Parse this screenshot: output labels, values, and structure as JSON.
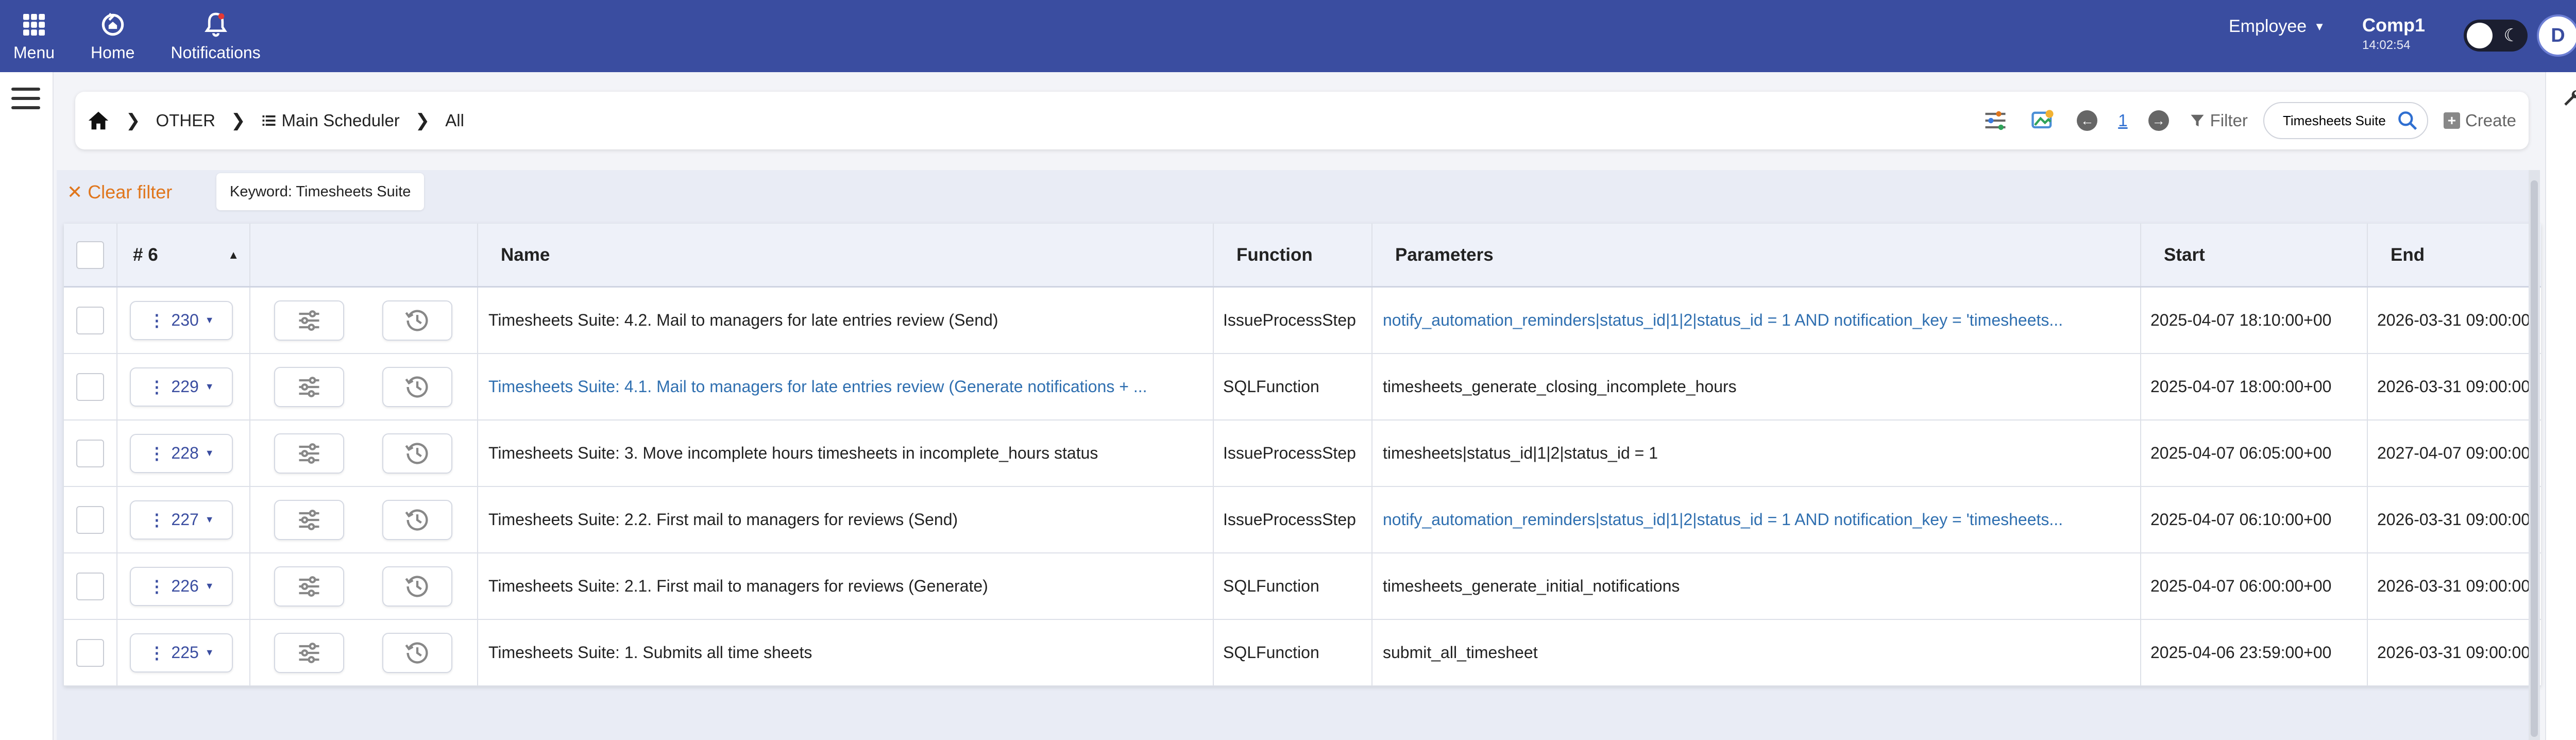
{
  "topbar": {
    "nav": [
      {
        "label": "Menu",
        "icon": "grid-icon"
      },
      {
        "label": "Home",
        "icon": "home-refresh-icon"
      },
      {
        "label": "Notifications",
        "icon": "bell-icon"
      }
    ],
    "role": "Employee",
    "company": "Comp1",
    "time": "14:02:54",
    "avatar": "D",
    "color": "#3a4da0"
  },
  "breadcrumb": {
    "items": [
      "OTHER",
      "Main Scheduler",
      "All"
    ]
  },
  "toolbar": {
    "page": "1",
    "filter_label": "Filter",
    "search_value": "Timesheets Suite",
    "create_label": "Create"
  },
  "filters": {
    "clear_label": "Clear filter",
    "chip": "Keyword: Timesheets Suite"
  },
  "table": {
    "count_label": "# 6",
    "columns": [
      "Name",
      "Function",
      "Parameters",
      "Start",
      "End"
    ],
    "rows": [
      {
        "id": "230",
        "name": "Timesheets Suite: 4.2. Mail to managers for late entries review (Send)",
        "name_link": false,
        "function": "IssueProcessStep",
        "parameters": "notify_automation_reminders|status_id|1|2|status_id = 1 AND notification_key = 'timesheets...",
        "params_link": true,
        "start": "2025-04-07 18:10:00+00",
        "end": "2026-03-31 09:00:00"
      },
      {
        "id": "229",
        "name": "Timesheets Suite: 4.1. Mail to managers for late entries review (Generate notifications + ...",
        "name_link": true,
        "function": "SQLFunction",
        "parameters": "timesheets_generate_closing_incomplete_hours",
        "params_link": false,
        "start": "2025-04-07 18:00:00+00",
        "end": "2026-03-31 09:00:00"
      },
      {
        "id": "228",
        "name": "Timesheets Suite: 3. Move incomplete hours timesheets in incomplete_hours status",
        "name_link": false,
        "function": "IssueProcessStep",
        "parameters": "timesheets|status_id|1|2|status_id = 1",
        "params_link": false,
        "start": "2025-04-07 06:05:00+00",
        "end": "2027-04-07 09:00:00"
      },
      {
        "id": "227",
        "name": "Timesheets Suite: 2.2. First mail to managers for reviews (Send)",
        "name_link": false,
        "function": "IssueProcessStep",
        "parameters": "notify_automation_reminders|status_id|1|2|status_id = 1 AND notification_key = 'timesheets...",
        "params_link": true,
        "start": "2025-04-07 06:10:00+00",
        "end": "2026-03-31 09:00:00"
      },
      {
        "id": "226",
        "name": "Timesheets Suite: 2.1. First mail to managers for reviews (Generate)",
        "name_link": false,
        "function": "SQLFunction",
        "parameters": "timesheets_generate_initial_notifications",
        "params_link": false,
        "start": "2025-04-07 06:00:00+00",
        "end": "2026-03-31 09:00:00"
      },
      {
        "id": "225",
        "name": "Timesheets Suite: 1. Submits all time sheets",
        "name_link": false,
        "function": "SQLFunction",
        "parameters": "submit_all_timesheet",
        "params_link": false,
        "start": "2025-04-06 23:59:00+00",
        "end": "2026-03-31 09:00:00"
      }
    ]
  }
}
